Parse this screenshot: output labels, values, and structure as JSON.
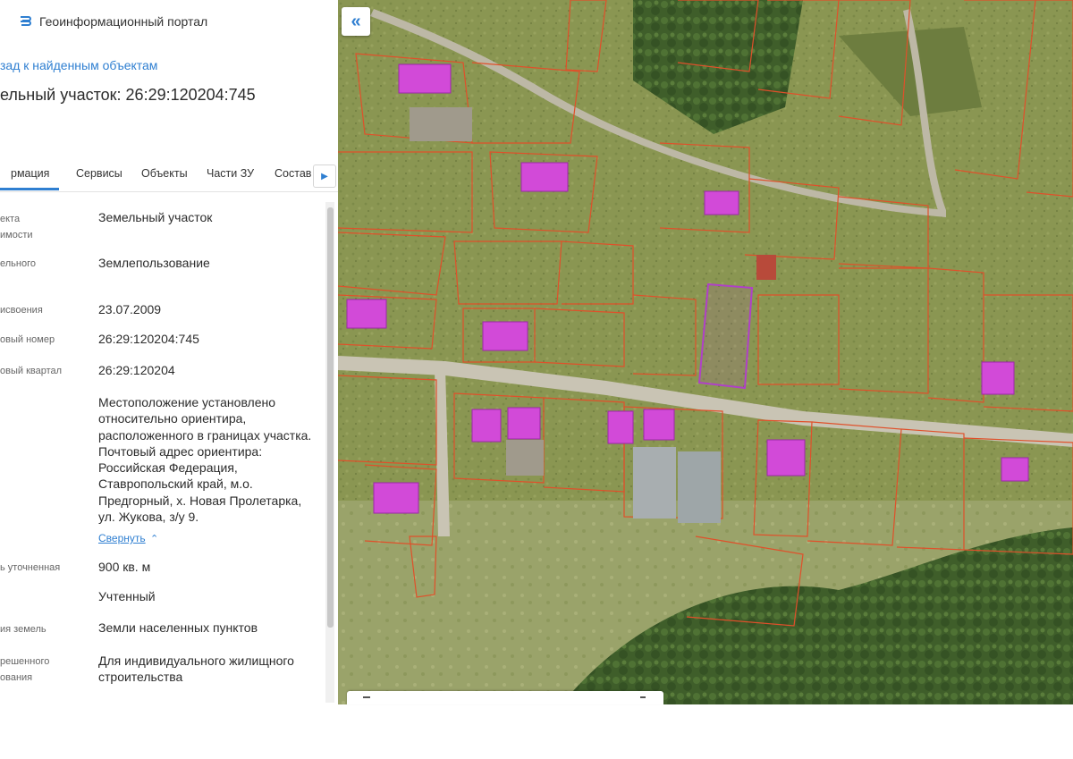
{
  "header": {
    "portal_title": "Геоинформационный портал"
  },
  "nav": {
    "back_link": "зад к найденным объектам"
  },
  "object": {
    "title": "ельный участок: 26:29:120204:745"
  },
  "tabs": [
    {
      "label": "рмация",
      "active": true
    },
    {
      "label": "Сервисы",
      "active": false
    },
    {
      "label": "Объекты",
      "active": false
    },
    {
      "label": "Части ЗУ",
      "active": false
    },
    {
      "label": "Состав",
      "active": false
    }
  ],
  "tab_next_icon": "chevron-right-icon",
  "props": {
    "type": {
      "label1": "екта",
      "label2": "имости",
      "value": "Земельный участок"
    },
    "right": {
      "label": "ельного",
      "value": "Землепользование"
    },
    "date": {
      "label": "исвоения",
      "value": "23.07.2009"
    },
    "cadnum": {
      "label": "овый номер",
      "value": "26:29:120204:745"
    },
    "quarter": {
      "label": "овый квартал",
      "value": "26:29:120204"
    },
    "address": {
      "lines": [
        "Местоположение установлено",
        "относительно ориентира,",
        "расположенного в границах участка.",
        "Почтовый адрес ориентира:",
        "Российская Федерация,",
        "Ставропольский край, м.о.",
        "Предгорный, х. Новая Пролетарка,",
        "ул. Жукова, з/у 9."
      ],
      "collapse_label": "Свернуть"
    },
    "area": {
      "label": "ь уточненная",
      "value": "900 кв. м"
    },
    "status": {
      "value": "Учтенный"
    },
    "category": {
      "label": "ия земель",
      "value": "Земли населенных пунктов"
    },
    "use": {
      "label1": "решенного",
      "label2": "ования",
      "value1": "Для индивидуального жилищного",
      "value2": "строительства"
    }
  },
  "map": {
    "collapse_icon": "double-chevron-left-icon",
    "selected_color": "#b040c8",
    "roof_color": "#d24ad8",
    "parcel_line_color": "#e0502a"
  }
}
